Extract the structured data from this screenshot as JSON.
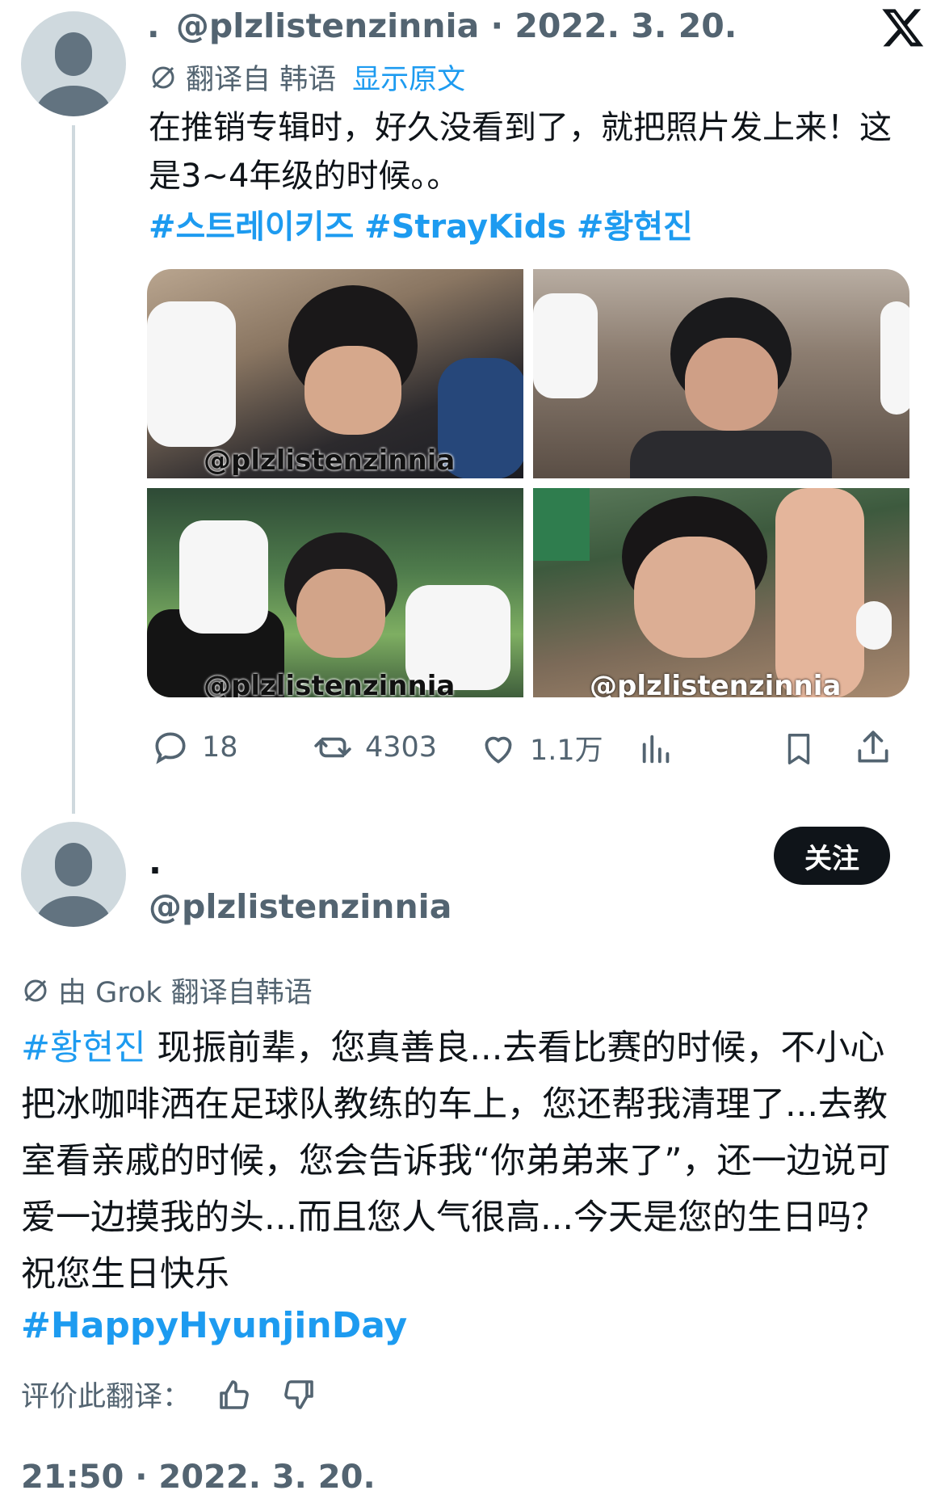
{
  "tweet1": {
    "name": ".",
    "handle_date": "@plzlistenzinnia · 2022. 3. 20.",
    "translated_from": "翻译自 韩语",
    "show_original": "显示原文",
    "text": "在推销专辑时，好久没看到了，就把照片发上来！这是3~4年级的时候。。",
    "hashtags": [
      "#스트레이키즈",
      "#StrayKids",
      "#황현진"
    ],
    "photo_watermarks": [
      "@plzlistenzinnia",
      "@plzlistenzinnia",
      "@plzlistenzinnia"
    ],
    "replies": "18",
    "retweets": "4303",
    "likes": "1.1万"
  },
  "tweet2": {
    "name": ".",
    "handle": "@plzlistenzinnia",
    "follow_label": "关注",
    "translated_by": "由 Grok 翻译自韩语",
    "hashtag": "#황현진",
    "text": "现振前辈，您真善良...去看比赛的时候，不小心把冰咖啡洒在足球队教练的车上，您还帮我清理了...去教室看亲戚的时候，您会告诉我“你弟弟来了”，还一边说可爱一边摸我的头...而且您人气很高...今天是您的生日吗？祝您生日快乐",
    "hashtag_end": "#HappyHyunjinDay",
    "rate_label": "评价此翻译：",
    "timestamp": "21:50 · 2022. 3. 20."
  },
  "colors": {
    "accent": "#1d9bf0",
    "text": "#0f1419",
    "muted": "#536471",
    "thread_line": "#cfd9de"
  },
  "icons": [
    "x-logo-icon",
    "translate-icon",
    "reply-icon",
    "retweet-icon",
    "like-icon",
    "views-icon",
    "bookmark-icon",
    "share-icon",
    "thumbs-up-icon",
    "thumbs-down-icon"
  ]
}
